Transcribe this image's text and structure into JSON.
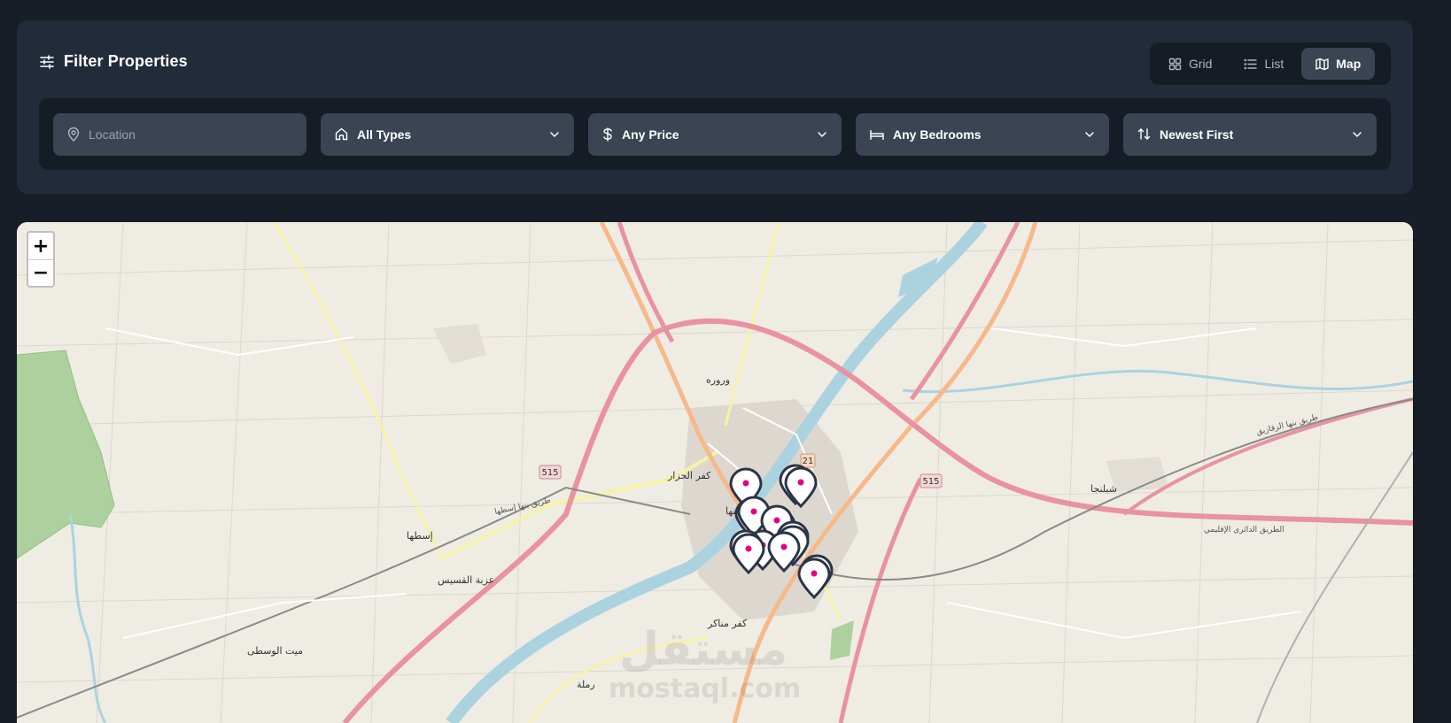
{
  "header": {
    "title": "Filter Properties",
    "icon": "sliders-icon"
  },
  "view_toggle": {
    "items": [
      {
        "label": "Grid",
        "icon": "grid-icon",
        "active": false
      },
      {
        "label": "List",
        "icon": "list-icon",
        "active": false
      },
      {
        "label": "Map",
        "icon": "map-icon",
        "active": true
      }
    ]
  },
  "filters": {
    "location": {
      "placeholder": "Location",
      "value": "",
      "icon": "location-pin-icon"
    },
    "type": {
      "selected": "All Types",
      "icon": "home-icon"
    },
    "price": {
      "selected": "Any Price",
      "icon": "dollar-icon"
    },
    "bedrooms": {
      "selected": "Any Bedrooms",
      "icon": "bed-icon"
    },
    "sort": {
      "selected": "Newest First",
      "icon": "sort-arrows-icon"
    }
  },
  "map": {
    "zoom_in": "+",
    "zoom_out": "−",
    "marker_color": "#e6007e",
    "marker_outline": "#2b3446",
    "place_labels": {
      "warwara": "وروره",
      "kafr_gazzar": "كفر الجزار",
      "itsa": "إسطها",
      "izbat_qusays": "عزبة القسيس",
      "mit_wasta": "ميت الوسطى",
      "ramla": "رملة",
      "kafr_manakir": "كفر مناكر",
      "shablanga": "شبلنجا",
      "banha": "بنها"
    },
    "road_labels": {
      "ring_road": "الطريق الدائري الإقليمي",
      "banha_itsa": "طريق بنها إسطها",
      "qaliub": "طريق بنها الزقازيق"
    },
    "shields": {
      "s515a": "515",
      "s515b": "515",
      "s21": "21"
    },
    "watermark": {
      "arabic": "مستقل",
      "latin": "mostaql.com"
    }
  }
}
